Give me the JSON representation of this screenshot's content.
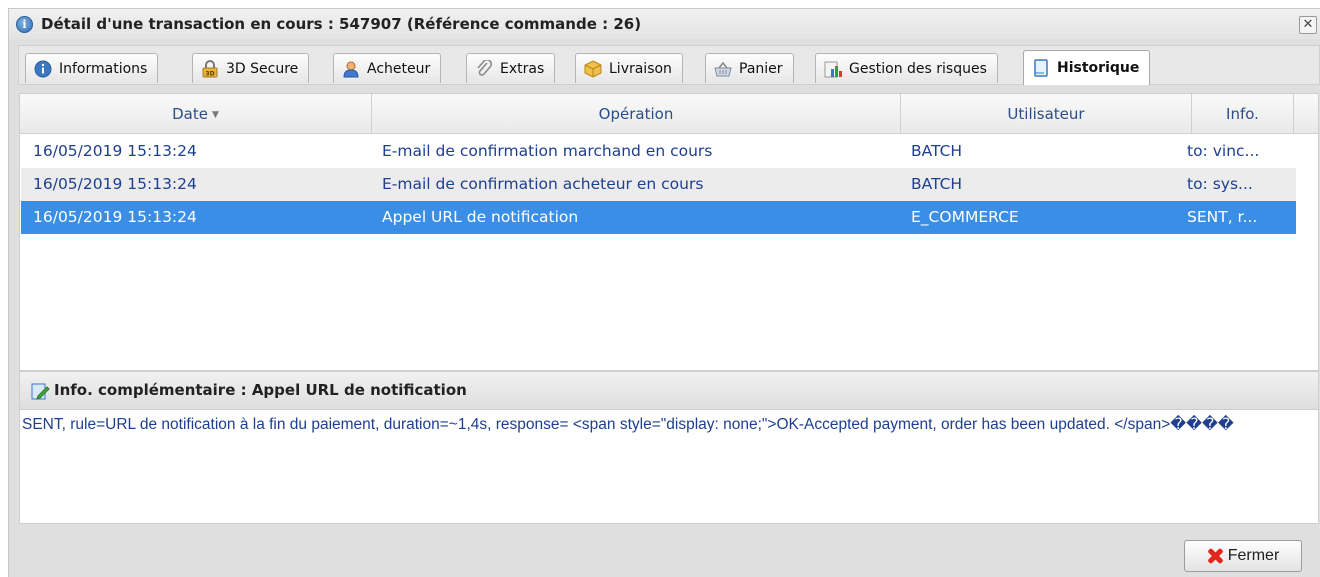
{
  "dialog": {
    "title": "Détail d'une transaction en cours : 547907 (Référence commande : 26)",
    "close_label": "✕"
  },
  "tabs": [
    {
      "label": "Informations",
      "icon": "info-icon",
      "active": false
    },
    {
      "label": "3D Secure",
      "icon": "lock-3d-icon",
      "active": false
    },
    {
      "label": "Acheteur",
      "icon": "buyer-user-icon",
      "active": false
    },
    {
      "label": "Extras",
      "icon": "paperclip-icon",
      "active": false
    },
    {
      "label": "Livraison",
      "icon": "package-icon",
      "active": false
    },
    {
      "label": "Panier",
      "icon": "basket-icon",
      "active": false
    },
    {
      "label": "Gestion des risques",
      "icon": "risk-chart-icon",
      "active": false
    },
    {
      "label": "Historique",
      "icon": "scroll-icon",
      "active": true
    }
  ],
  "grid": {
    "columns": [
      "Date",
      "Opération",
      "Utilisateur",
      "Info."
    ],
    "rows": [
      {
        "date": "16/05/2019 15:13:24",
        "operation": "E-mail de confirmation marchand en cours",
        "user": "BATCH",
        "info": "to: vinc..."
      },
      {
        "date": "16/05/2019 15:13:24",
        "operation": "E-mail de confirmation acheteur en cours",
        "user": "BATCH",
        "info": "to: sys..."
      },
      {
        "date": "16/05/2019 15:13:24",
        "operation": "Appel URL de notification",
        "user": "E_COMMERCE",
        "info": "SENT, r..."
      }
    ],
    "selected_row": 2
  },
  "detail": {
    "title": "Info. complémentaire : Appel URL de notification",
    "body": "SENT, rule=URL de notification à la fin du paiement, duration=~1,4s, response= <span style=\"display: none;\">OK-Accepted payment, order has been updated. </span>����"
  },
  "footer": {
    "close_button": "Fermer"
  },
  "colors": {
    "selection": "#3a8ee6",
    "link_text": "#1e3f8f",
    "header_text": "#2a4e8a",
    "close_red": "#e0271b"
  }
}
